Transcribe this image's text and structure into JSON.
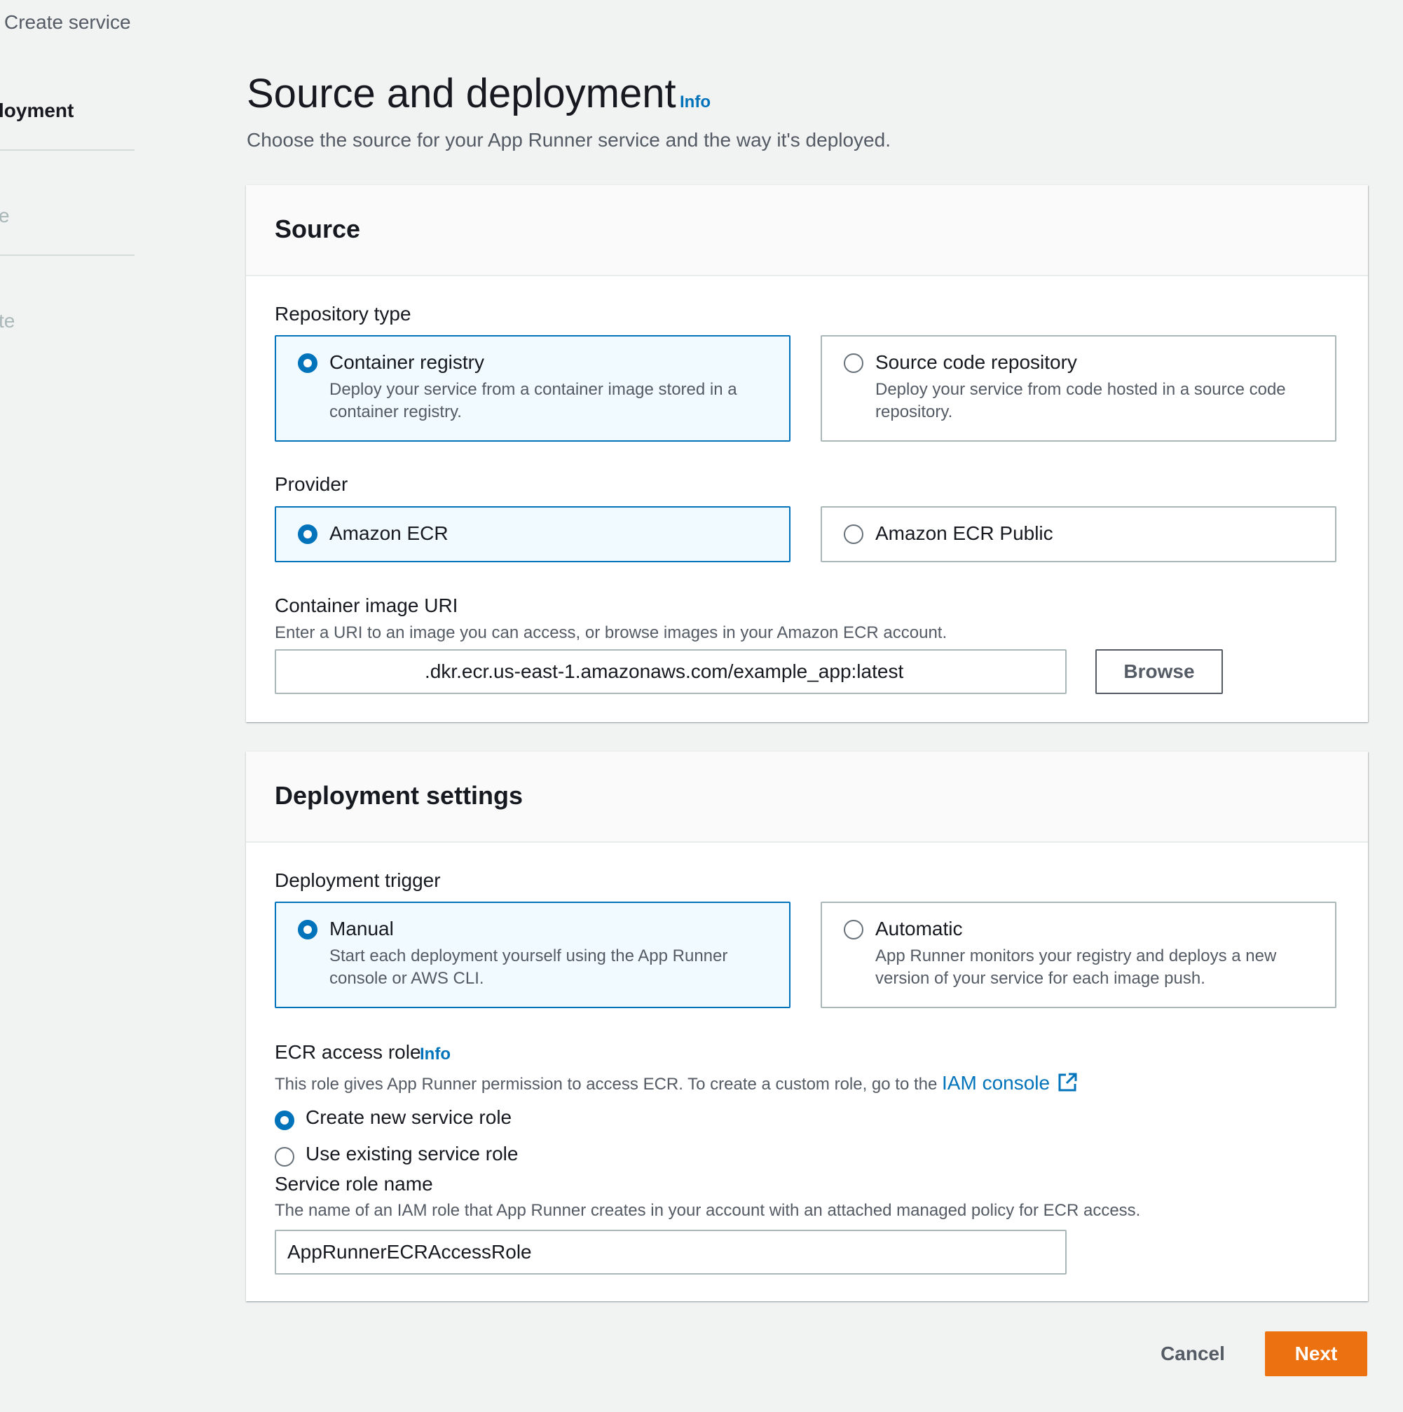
{
  "sidebar": {
    "breadcrumb": "Create service",
    "steps": [
      {
        "label": "loyment"
      },
      {
        "label": "e"
      },
      {
        "label": "te"
      }
    ]
  },
  "header": {
    "title": "Source and deployment",
    "info": "Info",
    "description": "Choose the source for your App Runner service and the way it's deployed."
  },
  "source": {
    "title": "Source",
    "repository_type": {
      "label": "Repository type",
      "options": [
        {
          "title": "Container registry",
          "description": "Deploy your service from a container image stored in a container registry.",
          "selected": true
        },
        {
          "title": "Source code repository",
          "description": "Deploy your service from code hosted in a source code repository.",
          "selected": false
        }
      ]
    },
    "provider": {
      "label": "Provider",
      "options": [
        {
          "title": "Amazon ECR",
          "selected": true
        },
        {
          "title": "Amazon ECR Public",
          "selected": false
        }
      ]
    },
    "image_uri": {
      "label": "Container image URI",
      "description": "Enter a URI to an image you can access, or browse images in your Amazon ECR account.",
      "value": ".dkr.ecr.us-east-1.amazonaws.com/example_app:latest",
      "browse_label": "Browse"
    }
  },
  "deployment": {
    "title": "Deployment settings",
    "trigger": {
      "label": "Deployment trigger",
      "options": [
        {
          "title": "Manual",
          "description": "Start each deployment yourself using the App Runner console or AWS CLI.",
          "selected": true
        },
        {
          "title": "Automatic",
          "description": "App Runner monitors your registry and deploys a new version of your service for each image push.",
          "selected": false
        }
      ]
    },
    "access_role": {
      "label": "ECR access role",
      "info": "Info",
      "description": "This role gives App Runner permission to access ECR. To create a custom role, go to the",
      "link_text": "IAM console",
      "options": [
        {
          "label": "Create new service role",
          "selected": true
        },
        {
          "label": "Use existing service role",
          "selected": false
        }
      ]
    },
    "service_role_name": {
      "label": "Service role name",
      "description": "The name of an IAM role that App Runner creates in your account with an attached managed policy for ECR access.",
      "value": "AppRunnerECRAccessRole"
    }
  },
  "footer": {
    "cancel_label": "Cancel",
    "next_label": "Next"
  },
  "colors": {
    "accent": "#0073bb",
    "primary_button": "#ec7211",
    "selected_tile_bg": "#f1faff"
  }
}
